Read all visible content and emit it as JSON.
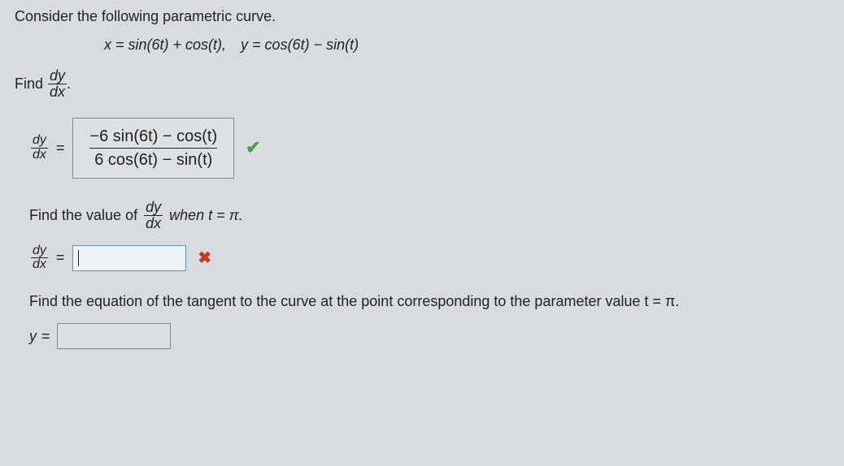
{
  "prompt": "Consider the following parametric curve.",
  "equations": "x = sin(6t) + cos(t), y = cos(6t) − sin(t)",
  "find_dy_dx": {
    "label": "Find",
    "frac_num": "dy",
    "frac_den": "dx",
    "period": "."
  },
  "dy_dx_answer": {
    "lhs_num": "dy",
    "lhs_den": "dx",
    "eq": "=",
    "rhs_num": "−6 sin(6t) − cos(t)",
    "rhs_den": "6 cos(6t) − sin(t)",
    "status": "correct"
  },
  "find_value": {
    "pre": "Find the value of",
    "frac_num": "dy",
    "frac_den": "dx",
    "post": "when t = π."
  },
  "dy_dx_value": {
    "lhs_num": "dy",
    "lhs_den": "dx",
    "eq": "=",
    "value": "",
    "status": "incorrect"
  },
  "tangent_prompt": "Find the equation of the tangent to the curve at the point corresponding to the parameter value t = π.",
  "y_eq": {
    "label": "y",
    "eq": "=",
    "value": ""
  }
}
